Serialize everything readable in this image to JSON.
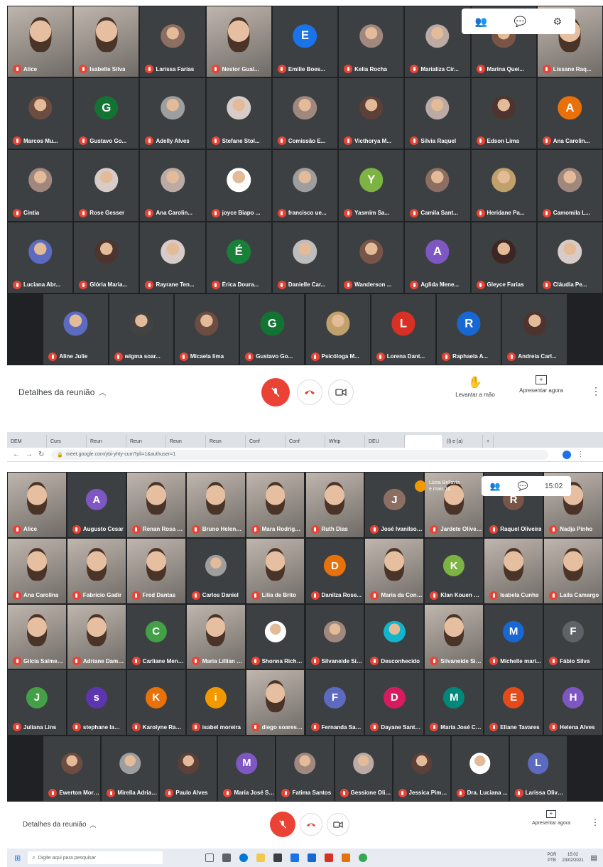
{
  "colors": {
    "stage": "#202124",
    "tile": "#3c4043",
    "muted_red": "#ea4335",
    "text_dark": "#3c4043"
  },
  "screen1": {
    "participants": [
      {
        "name": "Alice",
        "video": true
      },
      {
        "name": "Isabelle Silva",
        "video": true
      },
      {
        "name": "Larissa Farias",
        "avatar_color": "#8d6e63"
      },
      {
        "name": "Nestor Gual...",
        "video": true
      },
      {
        "name": "Emilie Boes...",
        "initial": "E",
        "avatar_color": "#1a73e8"
      },
      {
        "name": "Kelia Rocha",
        "avatar_color": "#a1887f"
      },
      {
        "name": "Marializa Cir...",
        "avatar_color": "#bcaaa4"
      },
      {
        "name": "Marina Quei...",
        "avatar_color": "#795548"
      },
      {
        "name": "Lissane Raq...",
        "video": true
      },
      {
        "name": "Marcos Mu...",
        "avatar_color": "#6d4c41"
      },
      {
        "name": "Gustavo Go...",
        "initial": "G",
        "avatar_color": "#137333"
      },
      {
        "name": "Adelly Alves",
        "avatar_color": "#9e9e9e"
      },
      {
        "name": "Stefane Stol...",
        "avatar_color": "#d7ccc8"
      },
      {
        "name": "Comissão E...",
        "avatar_color": "#a1887f"
      },
      {
        "name": "Victhorya M...",
        "avatar_color": "#5d4037"
      },
      {
        "name": "Silvia Raquel",
        "avatar_color": "#bcaaa4"
      },
      {
        "name": "Edson Lima",
        "avatar_color": "#4e342e"
      },
      {
        "name": "Ana Carolin...",
        "initial": "A",
        "avatar_color": "#e8710a"
      },
      {
        "name": "Cintia",
        "avatar_color": "#a1887f"
      },
      {
        "name": "Rose Gesser",
        "avatar_color": "#d7ccc8"
      },
      {
        "name": "Ana Carolin...",
        "avatar_color": "#bcaaa4"
      },
      {
        "name": "joyce Biapo ...",
        "avatar_color": "#ffffff"
      },
      {
        "name": "francisco ue...",
        "avatar_color": "#9e9e9e"
      },
      {
        "name": "Yasmim Sa...",
        "initial": "Y",
        "avatar_color": "#7cb342"
      },
      {
        "name": "Camila Sant...",
        "avatar_color": "#8d6e63"
      },
      {
        "name": "Heridane Pa...",
        "avatar_color": "#c0a16b"
      },
      {
        "name": "Camomila L...",
        "avatar_color": "#a1887f"
      },
      {
        "name": "Luciana Abr...",
        "avatar_color": "#5c6bc0"
      },
      {
        "name": "Glória Maria...",
        "avatar_color": "#4e342e"
      },
      {
        "name": "Rayrane Ten...",
        "avatar_color": "#d7ccc8"
      },
      {
        "name": "Érica Doura...",
        "initial": "É",
        "avatar_color": "#188038"
      },
      {
        "name": "Danielle Car...",
        "avatar_color": "#bdbdbd"
      },
      {
        "name": "Wanderson ...",
        "avatar_color": "#795548"
      },
      {
        "name": "Aglida Mene...",
        "initial": "A",
        "avatar_color": "#7e57c2"
      },
      {
        "name": "Gleyce Farias",
        "avatar_color": "#3e2723"
      },
      {
        "name": "Cláudia Pe...",
        "avatar_color": "#d7ccc8"
      },
      {
        "name": "Aline Julie",
        "avatar_color": "#5c6bc0"
      },
      {
        "name": "wigma soar...",
        "avatar_color": "#424242"
      },
      {
        "name": "Micaela lima",
        "avatar_color": "#6d4c41"
      },
      {
        "name": "Gustavo Go...",
        "initial": "G",
        "avatar_color": "#137333"
      },
      {
        "name": "Psicóloga M...",
        "avatar_color": "#c0a16b"
      },
      {
        "name": "Lorena Dant...",
        "initial": "L",
        "avatar_color": "#d93025"
      },
      {
        "name": "Raphaela A...",
        "initial": "R",
        "avatar_color": "#1967d2"
      },
      {
        "name": "Andreia Carl...",
        "avatar_color": "#4e342e"
      }
    ],
    "bottom": {
      "meeting_details": "Detalhes da reunião",
      "raise_hand": "Levantar a mão",
      "present_now": "Apresentar agora"
    }
  },
  "screen2": {
    "tabs": [
      "DEM",
      "Curs",
      "Reun",
      "Reun",
      "Reun",
      "Reun",
      "Conf",
      "Conf",
      "Whtp",
      "DEU",
      "",
      "(l) e (a)"
    ],
    "url": "meet.google.com/ybi-yhty-cum?pli=1&authuser=1",
    "presenter_label": "Lúcia Bellavia",
    "presenter_sub": "e mais 10",
    "time": "15:02",
    "participants": [
      {
        "name": "Alice",
        "video": true
      },
      {
        "name": "Augusto Cesar",
        "initial": "A",
        "avatar_color": "#7e57c2"
      },
      {
        "name": "Renan Rosa O...",
        "video": true
      },
      {
        "name": "Bruno Helena a...",
        "video": true
      },
      {
        "name": "Mara Rodrigues",
        "video": true
      },
      {
        "name": "Ruth Dias",
        "video": true
      },
      {
        "name": "José Ivanilson...",
        "initial": "J",
        "avatar_color": "#8d6e63"
      },
      {
        "name": "Jardete Oliveira",
        "video": true
      },
      {
        "name": "Raquel Oliveira",
        "initial": "R",
        "avatar_color": "#795548"
      },
      {
        "name": "Nadja Pinho",
        "video": true
      },
      {
        "name": "Ana Carolina",
        "video": true
      },
      {
        "name": "Fabrício Gadir",
        "video": true
      },
      {
        "name": "Fred Dantas",
        "video": true
      },
      {
        "name": "Carlos Daniel",
        "avatar_color": "#9e9e9e"
      },
      {
        "name": "Lilia de Brito",
        "video": true
      },
      {
        "name": "Danilza Rose...",
        "initial": "D",
        "avatar_color": "#e8710a"
      },
      {
        "name": "Maria da Cone...",
        "video": true
      },
      {
        "name": "Klan Kouen Le...",
        "initial": "K",
        "avatar_color": "#7cb342"
      },
      {
        "name": "Isabela Cunha",
        "video": true
      },
      {
        "name": "Laila Camargo",
        "video": true
      },
      {
        "name": "Gilcia Salmento",
        "video": true
      },
      {
        "name": "Adriane Dama...",
        "video": true
      },
      {
        "name": "Carliane Mend...",
        "initial": "C",
        "avatar_color": "#43a047"
      },
      {
        "name": "Maria Lillian M...",
        "video": true
      },
      {
        "name": "Shonna Richa...",
        "avatar_color": "#ffffff"
      },
      {
        "name": "Silvaneide Silv...",
        "avatar_color": "#a1887f"
      },
      {
        "name": "Desconhecido",
        "avatar_color": "#12b5cb"
      },
      {
        "name": "Silvaneide Silv...",
        "video": true
      },
      {
        "name": "Michelle mari...",
        "initial": "M",
        "avatar_color": "#1967d2"
      },
      {
        "name": "Fábio Silva",
        "initial": "F",
        "avatar_color": "#5f6368"
      },
      {
        "name": "Juliana Lins",
        "initial": "J",
        "avatar_color": "#43a047"
      },
      {
        "name": "stephane lamb...",
        "initial": "s",
        "avatar_color": "#5e35b1"
      },
      {
        "name": "Karolyne Ram...",
        "initial": "K",
        "avatar_color": "#e8710a"
      },
      {
        "name": "isabel moreira",
        "initial": "i",
        "avatar_color": "#f29900"
      },
      {
        "name": "diego soares a...",
        "video": true
      },
      {
        "name": "Fernanda Santos",
        "initial": "F",
        "avatar_color": "#5c6bc0"
      },
      {
        "name": "Dayane Santa...",
        "initial": "D",
        "avatar_color": "#d81b60"
      },
      {
        "name": "Maria José Ca...",
        "initial": "M",
        "avatar_color": "#00897b"
      },
      {
        "name": "Eliane Tavares",
        "initial": "E",
        "avatar_color": "#e64a19"
      },
      {
        "name": "Helena Alves",
        "initial": "H",
        "avatar_color": "#7e57c2"
      },
      {
        "name": "Ewerton Moreira",
        "avatar_color": "#6d4c41"
      },
      {
        "name": "Mirella Adrian...",
        "avatar_color": "#9e9e9e"
      },
      {
        "name": "Paulo Alves",
        "avatar_color": "#5d4037"
      },
      {
        "name": "Maria José Sa...",
        "initial": "M",
        "avatar_color": "#7e57c2"
      },
      {
        "name": "Fatima Santos",
        "avatar_color": "#a1887f"
      },
      {
        "name": "Gessione Olive...",
        "avatar_color": "#bcaaa4"
      },
      {
        "name": "Jessica Piment...",
        "avatar_color": "#5d4037"
      },
      {
        "name": "Dra. Luciana ...",
        "avatar_color": "#ffffff"
      },
      {
        "name": "Larissa Oliveira",
        "initial": "L",
        "avatar_color": "#5c6bc0"
      }
    ],
    "bottom": {
      "meeting_details": "Detalhes da reunião",
      "present_now": "Apresentar agora"
    },
    "taskbar": {
      "search_placeholder": "Digite aqui para pesquisar",
      "lang": "POR",
      "lang2": "PTB",
      "clock": "15:02",
      "date": "23/02/2021"
    }
  }
}
